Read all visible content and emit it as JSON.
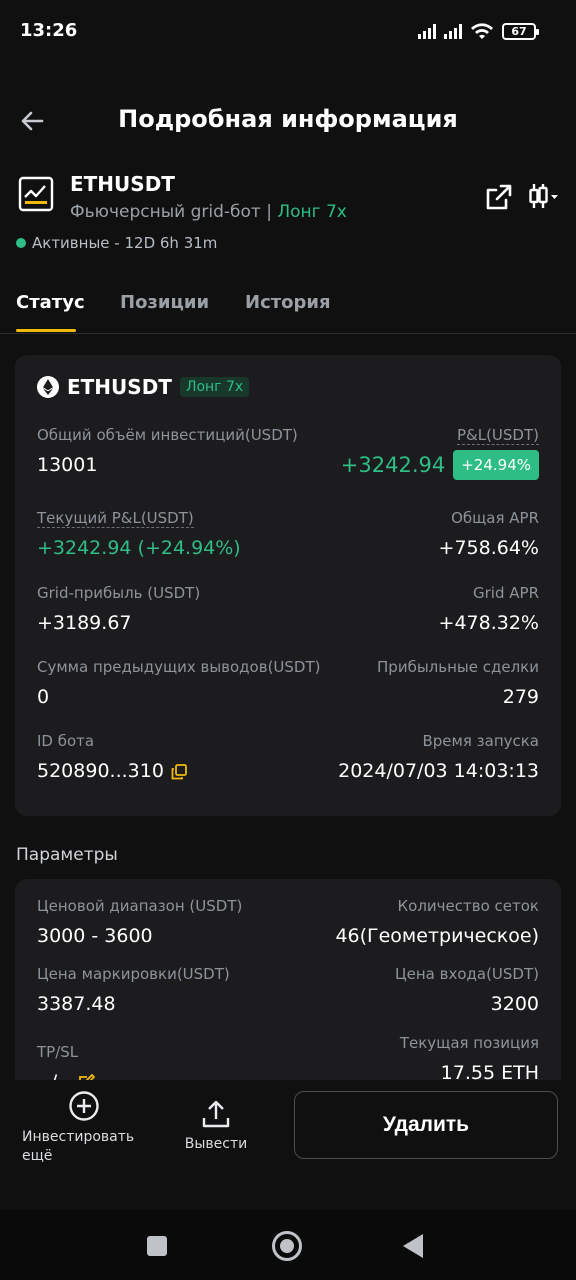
{
  "status_bar": {
    "time": "13:26",
    "battery": "67"
  },
  "header": {
    "title": "Подробная информация"
  },
  "bot": {
    "symbol": "ETHUSDT",
    "type_label": "Фьючерсный grid-бот |",
    "direction": "Лонг 7x",
    "status": "Активные - 12D 6h 31m"
  },
  "tabs": [
    {
      "label": "Статус",
      "active": true
    },
    {
      "label": "Позиции",
      "active": false
    },
    {
      "label": "История",
      "active": false
    }
  ],
  "summary": {
    "symbol": "ETHUSDT",
    "direction": "Лонг 7x",
    "total_investment_label": "Общий объём инвестиций(USDT)",
    "total_investment_value": "13001",
    "pnl_label": "P&L(USDT)",
    "pnl_value": "+3242.94",
    "pnl_percent": "+24.94%",
    "current_pnl_label": "Текущий P&L(USDT)",
    "current_pnl_value": "+3242.94 (+24.94%)",
    "total_apr_label": "Общая APR",
    "total_apr_value": "+758.64%",
    "grid_profit_label": "Grid-прибыль (USDT)",
    "grid_profit_value": "+3189.67",
    "grid_apr_label": "Grid APR",
    "grid_apr_value": "+478.32%",
    "prev_withdrawals_label": "Сумма предыдущих выводов(USDT)",
    "prev_withdrawals_value": "0",
    "profitable_trades_label": "Прибыльные сделки",
    "profitable_trades_value": "279",
    "bot_id_label": "ID бота",
    "bot_id_value": "520890...310",
    "start_time_label": "Время запуска",
    "start_time_value": "2024/07/03 14:03:13"
  },
  "params": {
    "title": "Параметры",
    "price_range_label": "Ценовой диапазон (USDT)",
    "price_range_value": "3000 - 3600",
    "grid_count_label": "Количество сеток",
    "grid_count_value": "46(Геометрическое)",
    "mark_price_label": "Цена маркировки(USDT)",
    "mark_price_value": "3387.48",
    "entry_price_label": "Цена входа(USDT)",
    "entry_price_value": "3200",
    "tpsl_label": "TP/SL",
    "tpsl_value": "--/--",
    "current_position_label": "Текущая позиция",
    "current_position_value": "17.55 ETH"
  },
  "actions": {
    "invest_more": "Инвестировать ещё",
    "withdraw": "Вывести",
    "delete": "Удалить"
  },
  "colors": {
    "green": "#2ebd85",
    "accent": "#f0b90b",
    "card": "#1c1c1e"
  }
}
